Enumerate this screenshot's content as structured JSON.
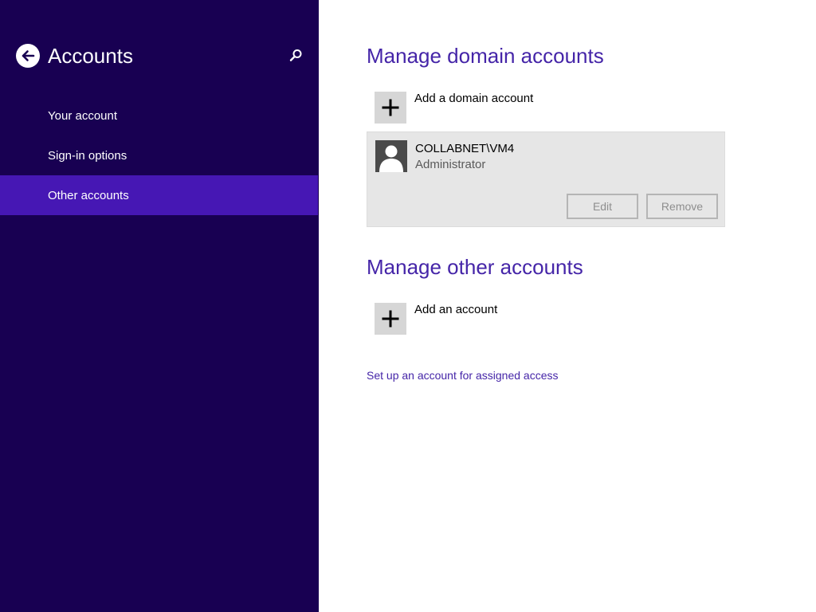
{
  "colors": {
    "sidebar_bg": "#180052",
    "sidebar_active": "#4617b4",
    "accent_text": "#4525a8",
    "card_bg": "#e6e6e6"
  },
  "sidebar": {
    "back_icon": "back-arrow-icon",
    "title": "Accounts",
    "search_icon": "search-icon",
    "items": [
      {
        "label": "Your account",
        "active": false
      },
      {
        "label": "Sign-in options",
        "active": false
      },
      {
        "label": "Other accounts",
        "active": true
      }
    ]
  },
  "main": {
    "domain_section": {
      "title": "Manage domain accounts",
      "add_label": "Add a domain account",
      "add_icon": "plus-icon",
      "account": {
        "avatar_icon": "user-avatar-icon",
        "name": "COLLABNET\\VM4",
        "role": "Administrator",
        "edit_label": "Edit",
        "remove_label": "Remove"
      }
    },
    "other_section": {
      "title": "Manage other accounts",
      "add_label": "Add an account",
      "add_icon": "plus-icon"
    },
    "assigned_access_link": "Set up an account for assigned access"
  }
}
